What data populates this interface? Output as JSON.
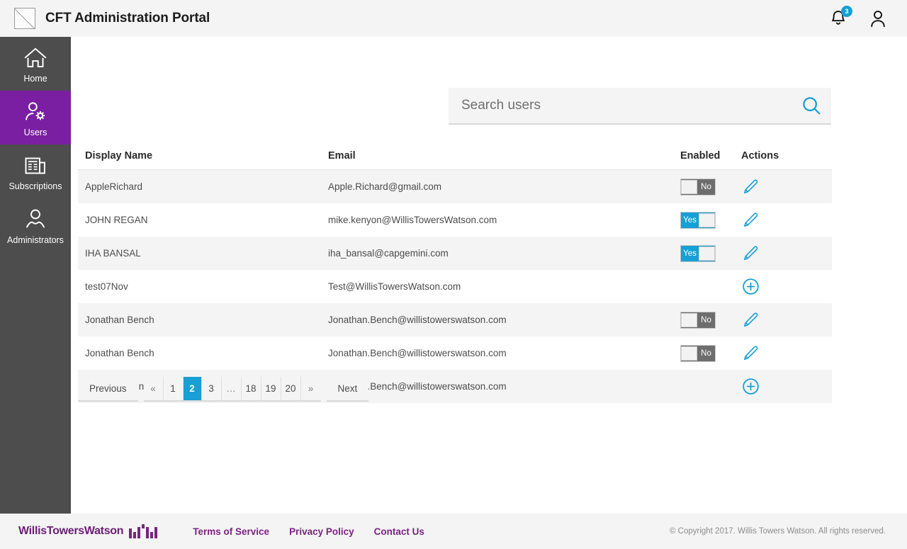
{
  "header": {
    "title": "CFT Administration Portal",
    "logo_icon": "image-placeholder-icon",
    "notifications": {
      "icon": "bell-icon",
      "count": "3"
    },
    "account": {
      "icon": "user-icon"
    }
  },
  "sidebar": {
    "items": [
      {
        "label": "Home",
        "icon": "home-icon",
        "active": false
      },
      {
        "label": "Users",
        "icon": "user-gear-icon",
        "active": true
      },
      {
        "label": "Subscriptions",
        "icon": "newspaper-icon",
        "active": false
      },
      {
        "label": "Administrators",
        "icon": "people-icon",
        "active": false
      }
    ],
    "active_color": "#7b1fa2",
    "background": "#4d4d4d"
  },
  "search": {
    "placeholder": "Search users",
    "value": "",
    "icon": "search-icon"
  },
  "table": {
    "columns": [
      "Display Name",
      "Email",
      "Enabled",
      "Actions"
    ],
    "rows": [
      {
        "display_name": "AppleRichard",
        "email": "Apple.Richard@gmail.com",
        "enabled": "No",
        "enabled_state": "off",
        "action_icon": "pencil-icon"
      },
      {
        "display_name": "JOHN REGAN",
        "email": "mike.kenyon@WillisTowersWatson.com",
        "enabled": "Yes",
        "enabled_state": "on",
        "action_icon": "pencil-icon"
      },
      {
        "display_name": "IHA BANSAL",
        "email": "iha_bansal@capgemini.com",
        "enabled": "Yes",
        "enabled_state": "on",
        "action_icon": "pencil-icon"
      },
      {
        "display_name": "test07Nov",
        "email": "Test@WillisTowersWatson.com",
        "enabled": "",
        "enabled_state": "none",
        "action_icon": "plus-circle-icon"
      },
      {
        "display_name": "Jonathan Bench",
        "email": "Jonathan.Bench@willistowerswatson.com",
        "enabled": "No",
        "enabled_state": "off",
        "action_icon": "pencil-icon"
      },
      {
        "display_name": "Jonathan Bench",
        "email": "Jonathan.Bench@willistowerswatson.com",
        "enabled": "No",
        "enabled_state": "off",
        "action_icon": "pencil-icon"
      },
      {
        "display_name": "Jonathan Bench",
        "email": "Jonathan.Bench@willistowerswatson.com",
        "enabled": "",
        "enabled_state": "none",
        "action_icon": "plus-circle-icon"
      }
    ]
  },
  "pagination": {
    "previous_label": "Previous",
    "next_label": "Next",
    "pages": [
      "«",
      "1",
      "2",
      "3",
      "…",
      "18",
      "19",
      "20",
      "»"
    ],
    "current_page": "2",
    "active_color": "#189fd4"
  },
  "footer": {
    "brand": "WillisTowersWatson",
    "links": [
      "Terms of Service",
      "Privacy Policy",
      "Contact Us"
    ],
    "copyright": "© Copyright 2017. Willis Towers Watson. All rights reserved.",
    "brand_color": "#7b2382"
  },
  "colors": {
    "accent": "#189fd4",
    "purple": "#7b1fa2",
    "sidebar": "#4d4d4d",
    "row_alt": "#f4f4f4"
  }
}
